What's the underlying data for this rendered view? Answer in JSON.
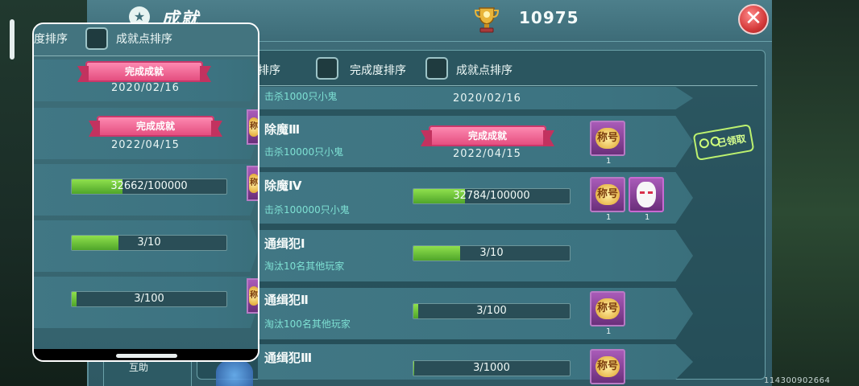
{
  "header": {
    "title": "成就",
    "points": "10975",
    "close_label": "✕"
  },
  "sort": {
    "option_all": "入排序",
    "option_completion": "完成度排序",
    "option_points": "成就点排序"
  },
  "achievements": [
    {
      "name": "",
      "desc": "击杀1000只小鬼",
      "status": "done",
      "date": "2020/02/16"
    },
    {
      "name": "除魔Ⅲ",
      "desc": "击杀10000只小鬼",
      "status": "done",
      "ribbon": "完成成就",
      "date": "2022/04/15",
      "rewards": [
        {
          "type": "title",
          "label": "称号",
          "count": "1"
        }
      ],
      "claimed": "已领取"
    },
    {
      "name": "除魔Ⅳ",
      "desc": "击杀100000只小鬼",
      "progress_text": "32784/100000",
      "progress": 0.32784,
      "rewards": [
        {
          "type": "title",
          "label": "称号",
          "count": "1"
        },
        {
          "type": "mask",
          "label": "",
          "count": "1"
        }
      ]
    },
    {
      "name": "通缉犯Ⅰ",
      "desc": "淘汰10名其他玩家",
      "progress_text": "3/10",
      "progress": 0.3
    },
    {
      "name": "通缉犯Ⅱ",
      "desc": "淘汰100名其他玩家",
      "progress_text": "3/100",
      "progress": 0.03,
      "rewards": [
        {
          "type": "title",
          "label": "称号",
          "count": "1"
        }
      ]
    },
    {
      "name": "通缉犯Ⅲ",
      "desc": "",
      "progress_text": "3/1000",
      "progress": 0.003,
      "rewards": [
        {
          "type": "title",
          "label": "称号",
          "count": ""
        }
      ]
    }
  ],
  "float_window": {
    "sort_completion": "度排序",
    "sort_points": "成就点排序",
    "items": [
      {
        "ribbon": "完成成就",
        "date": "2020/02/16"
      },
      {
        "ribbon": "完成成就",
        "date": "2022/04/15"
      },
      {
        "progress_text": "32662/100000",
        "progress": 0.32662
      },
      {
        "progress_text": "3/10",
        "progress": 0.3
      },
      {
        "progress_text": "3/100",
        "progress": 0.03
      }
    ]
  },
  "assist": {
    "label": "互助"
  },
  "watermark": "114300902664",
  "colors": {
    "accent": "#e2497b",
    "progress": "#6cc23a",
    "panel": "#3a6672"
  }
}
